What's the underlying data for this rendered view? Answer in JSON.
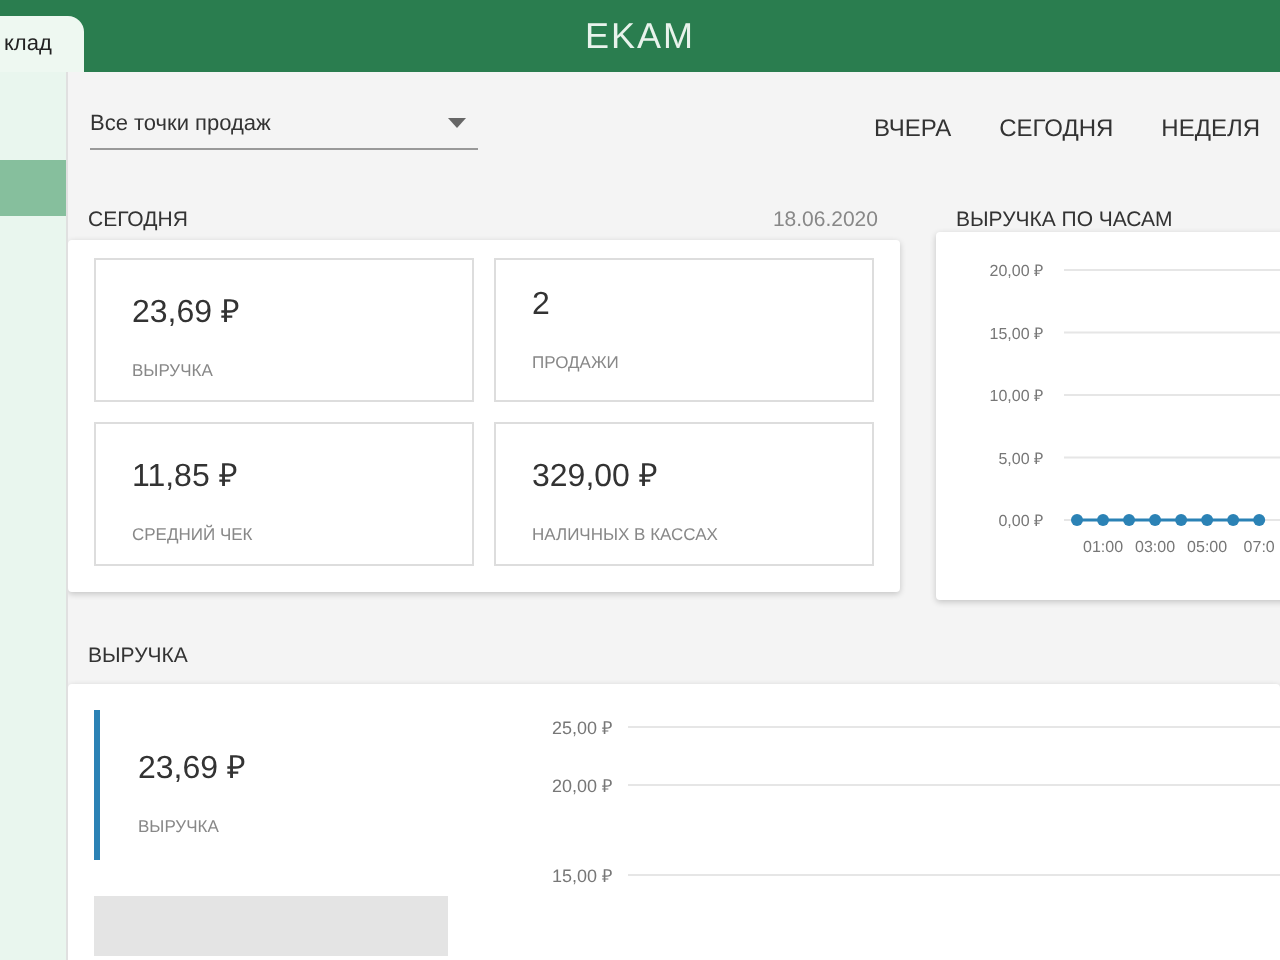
{
  "header": {
    "tab": "клад",
    "logo": "EKAM"
  },
  "sidebar": {
    "items": [
      {
        "selected": true
      }
    ]
  },
  "toolbar": {
    "dropdown": {
      "value": "Все точки продаж"
    },
    "periods": [
      {
        "label": "ВЧЕРА",
        "selected": false
      },
      {
        "label": "СЕГОДНЯ",
        "selected": false
      },
      {
        "label": "НЕДЕЛЯ",
        "selected": false
      }
    ]
  },
  "today": {
    "title": "СЕГОДНЯ",
    "date": "18.06.2020",
    "tiles": [
      {
        "value": "23,69 ₽",
        "label": "ВЫРУЧКА"
      },
      {
        "value": "2",
        "label": "ПРОДАЖИ"
      },
      {
        "value": "11,85 ₽",
        "label": "СРЕДНИЙ ЧЕК"
      },
      {
        "value": "329,00 ₽",
        "label": "НАЛИЧНЫХ В КАССАХ"
      }
    ]
  },
  "hourly": {
    "title": "ВЫРУЧКА ПО ЧАСАМ",
    "chart_data": {
      "type": "line",
      "x": [
        0,
        1,
        2,
        3,
        4,
        5,
        6,
        7
      ],
      "series": [
        {
          "color": "#2b82b5",
          "marker": "circle",
          "values": [
            0,
            0,
            0,
            0,
            0,
            0,
            0,
            0
          ]
        }
      ],
      "xlim": [
        -0.5,
        7.8
      ],
      "ylim": [
        0,
        20
      ],
      "grid": true,
      "yticks": [
        {
          "value": 20,
          "label": "20,00 ₽"
        },
        {
          "value": 15,
          "label": "15,00 ₽"
        },
        {
          "value": 10,
          "label": "10,00 ₽"
        },
        {
          "value": 5,
          "label": "5,00 ₽"
        },
        {
          "value": 0,
          "label": "0,00 ₽"
        }
      ],
      "xticks": [
        {
          "value": 1,
          "label": "01:00"
        },
        {
          "value": 3,
          "label": "03:00"
        },
        {
          "value": 5,
          "label": "05:00"
        },
        {
          "value": 7,
          "label": "07:0"
        }
      ]
    }
  },
  "revenue": {
    "title": "ВЫРУЧКА",
    "summary": {
      "value": "23,69 ₽",
      "label": "ВЫРУЧКА",
      "color": "#2b82b5"
    },
    "axis_labels": [
      "25,00 ₽",
      "20,00 ₽",
      "15,00 ₽"
    ]
  }
}
